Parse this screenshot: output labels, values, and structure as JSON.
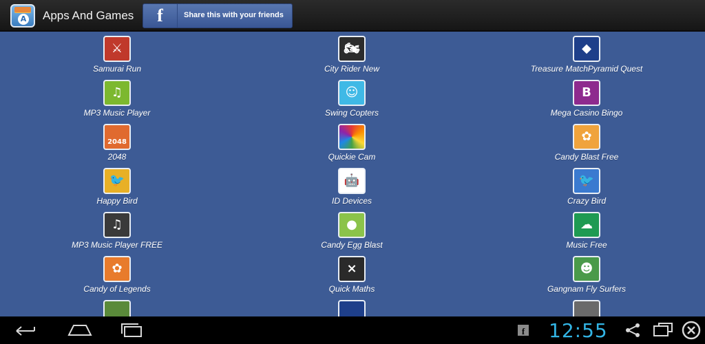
{
  "header": {
    "title": "Apps And Games",
    "share_label": "Share this with your friends",
    "fb_glyph": "f"
  },
  "apps": [
    [
      {
        "name": "Samurai Run",
        "icon": "samurai-run-icon",
        "bg": "#c0392b",
        "glyph": "⚔"
      },
      {
        "name": "City Rider New",
        "icon": "city-rider-icon",
        "bg": "#2c2c2c",
        "glyph": "🏍"
      },
      {
        "name": "Treasure MatchPyramid Quest",
        "icon": "treasure-match-icon",
        "bg": "#1e3f8a",
        "glyph": "◆"
      }
    ],
    [
      {
        "name": "MP3 Music Player",
        "icon": "music-note-icon",
        "bg": "#7cb82f",
        "glyph": "♫"
      },
      {
        "name": "Swing Copters",
        "icon": "swing-copters-icon",
        "bg": "#3fb9e6",
        "glyph": "☺"
      },
      {
        "name": "Mega Casino Bingo",
        "icon": "casino-bingo-icon",
        "bg": "#8e2a8e",
        "glyph": "B"
      }
    ],
    [
      {
        "name": "2048",
        "icon": "game-2048-icon",
        "bg": "#e06a2f",
        "glyph": "2048"
      },
      {
        "name": "Quickie Cam",
        "icon": "camera-color-wheel-icon",
        "bg": "#ffffff",
        "glyph": ""
      },
      {
        "name": "Candy Blast Free",
        "icon": "candy-blast-icon",
        "bg": "#f0a33c",
        "glyph": "✿"
      }
    ],
    [
      {
        "name": "Happy Bird",
        "icon": "happy-bird-icon",
        "bg": "#e8b026",
        "glyph": "🐦"
      },
      {
        "name": "ID Devices",
        "icon": "android-robot-icon",
        "bg": "#ffffff",
        "glyph": "🤖"
      },
      {
        "name": "Crazy Bird",
        "icon": "crazy-bird-icon",
        "bg": "#3a7ad0",
        "glyph": "🐦"
      }
    ],
    [
      {
        "name": "MP3 Music Player FREE",
        "icon": "download-music-icon",
        "bg": "#3a3a3a",
        "glyph": "♫"
      },
      {
        "name": "Candy Egg Blast",
        "icon": "candy-egg-icon",
        "bg": "#8bc34a",
        "glyph": "●"
      },
      {
        "name": "Music Free",
        "icon": "music-cloud-icon",
        "bg": "#1e9a52",
        "glyph": "☁"
      }
    ],
    [
      {
        "name": "Candy of Legends",
        "icon": "candy-legends-icon",
        "bg": "#e87b2c",
        "glyph": "✿"
      },
      {
        "name": "Quick Maths",
        "icon": "quick-maths-icon",
        "bg": "#2a2a2a",
        "glyph": "×"
      },
      {
        "name": "Gangnam Fly Surfers",
        "icon": "gangnam-surfers-icon",
        "bg": "#4a9a4a",
        "glyph": "☻"
      }
    ],
    [
      {
        "name": "",
        "icon": "partial-app-icon",
        "bg": "#5a8a3a",
        "glyph": ""
      },
      {
        "name": "",
        "icon": "partial-app-icon",
        "bg": "#1e3f8a",
        "glyph": ""
      },
      {
        "name": "",
        "icon": "partial-app-icon",
        "bg": "#6a6a6a",
        "glyph": ""
      }
    ]
  ],
  "statusbar": {
    "time": "12:55",
    "clock_color": "#33b5e5"
  },
  "colors": {
    "content_bg": "#3d5b95",
    "facebook_blue": "#3a5795"
  }
}
